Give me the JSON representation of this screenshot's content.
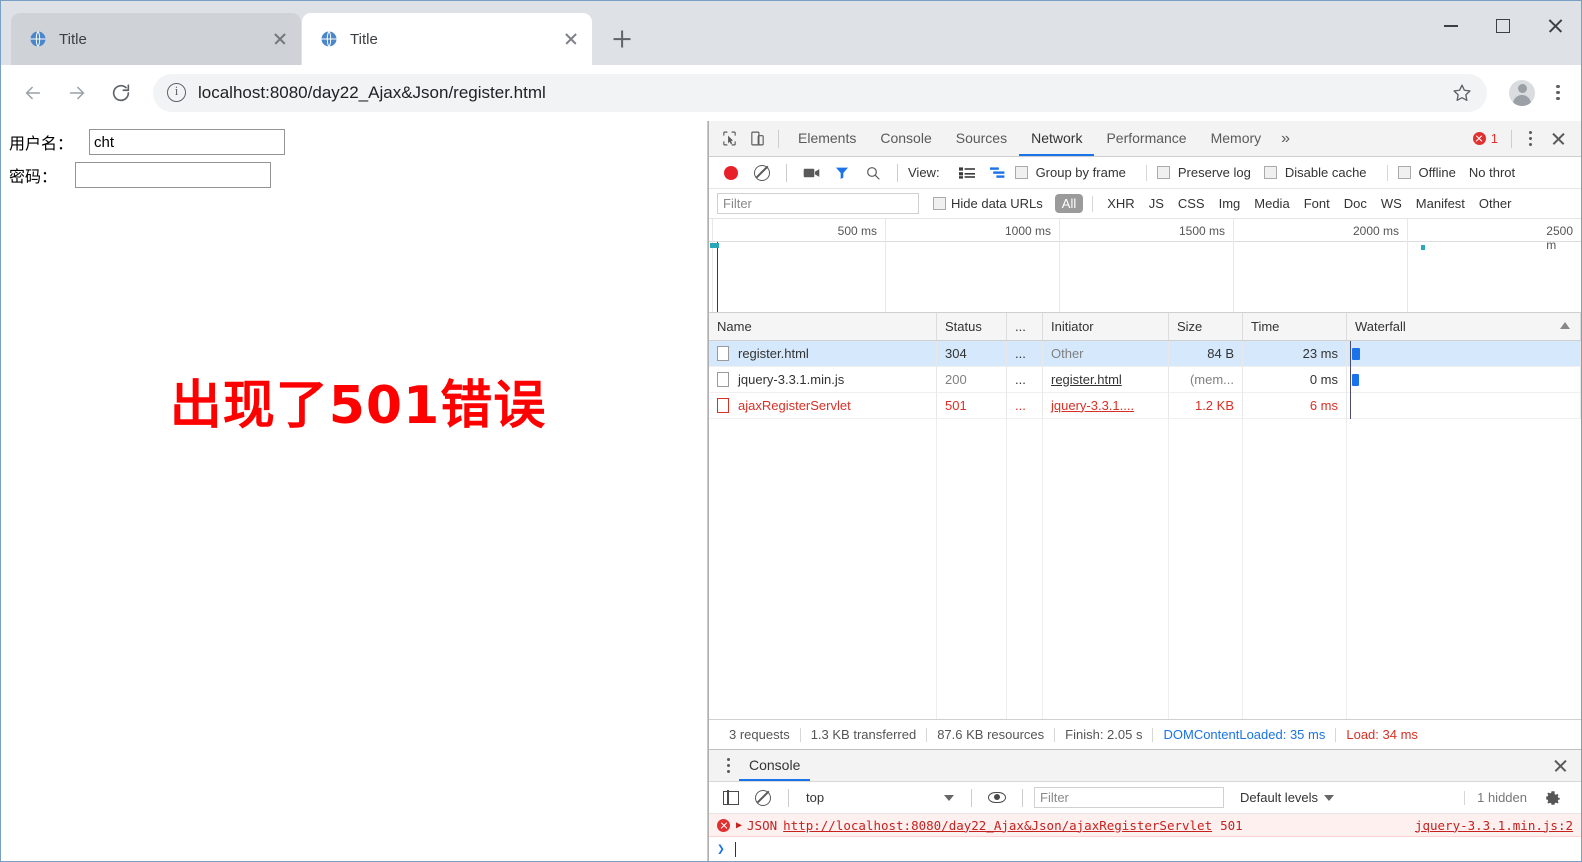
{
  "browser": {
    "tabs": [
      {
        "title": "Title",
        "active": false
      },
      {
        "title": "Title",
        "active": true
      }
    ],
    "new_tab_label": "+",
    "url": "localhost:8080/day22_Ajax&Json/register.html",
    "window_controls": {
      "minimize": "–",
      "maximize": "□",
      "close": "✕"
    }
  },
  "page": {
    "username_label": "用户名：",
    "username_value": "cht",
    "password_label": "密码：",
    "password_value": "",
    "error_text": "出现了501错误",
    "error_color": "#ff0000"
  },
  "devtools": {
    "panel_tabs": [
      {
        "label": "Elements",
        "active": false
      },
      {
        "label": "Console",
        "active": false
      },
      {
        "label": "Sources",
        "active": false
      },
      {
        "label": "Network",
        "active": true
      },
      {
        "label": "Performance",
        "active": false
      },
      {
        "label": "Memory",
        "active": false
      }
    ],
    "more_tabs": "»",
    "error_count": "1",
    "network_toolbar": {
      "view_label": "View:",
      "group_by_frame": "Group by frame",
      "preserve_log": "Preserve log",
      "disable_cache": "Disable cache",
      "offline": "Offline",
      "throttling": "No throt"
    },
    "filter_bar": {
      "filter_placeholder": "Filter",
      "hide_data_urls": "Hide data URLs",
      "types": [
        "All",
        "XHR",
        "JS",
        "CSS",
        "Img",
        "Media",
        "Font",
        "Doc",
        "WS",
        "Manifest",
        "Other"
      ],
      "active_type": "All"
    },
    "timeline": {
      "ticks": [
        "500 ms",
        "1000 ms",
        "1500 ms",
        "2000 ms",
        "2500 m"
      ]
    },
    "table": {
      "columns": [
        "Name",
        "Status",
        "...",
        "Initiator",
        "Size",
        "Time",
        "Waterfall"
      ],
      "rows": [
        {
          "name": "register.html",
          "status": "304",
          "dots": "...",
          "initiator": "Other",
          "size": "84 B",
          "time": "23 ms",
          "selected": true,
          "error": false,
          "initiator_link": false
        },
        {
          "name": "jquery-3.3.1.min.js",
          "status": "200",
          "dots": "...",
          "initiator": "register.html",
          "size": "(mem...",
          "time": "0 ms",
          "selected": false,
          "error": false,
          "initiator_link": true
        },
        {
          "name": "ajaxRegisterServlet",
          "status": "501",
          "dots": "...",
          "initiator": "jquery-3.3.1....",
          "size": "1.2 KB",
          "time": "6 ms",
          "selected": false,
          "error": true,
          "initiator_link": true
        }
      ]
    },
    "status_bar": {
      "requests": "3 requests",
      "transferred": "1.3 KB transferred",
      "resources": "87.6 KB resources",
      "finish": "Finish: 2.05 s",
      "dom_content_loaded": "DOMContentLoaded: 35 ms",
      "load": "Load: 34 ms",
      "dcl_color": "#1a73e8",
      "load_color": "#d93025"
    },
    "drawer": {
      "tab_label": "Console",
      "context": "top",
      "filter_placeholder": "Filter",
      "levels": "Default levels",
      "hidden": "1 hidden",
      "messages": [
        {
          "prefix": "JSON",
          "url": "http://localhost:8080/day22_Ajax&Json/ajaxRegisterServlet",
          "status": "501",
          "source": "jquery-3.3.1.min.js:2"
        }
      ],
      "prompt": "❯"
    }
  }
}
